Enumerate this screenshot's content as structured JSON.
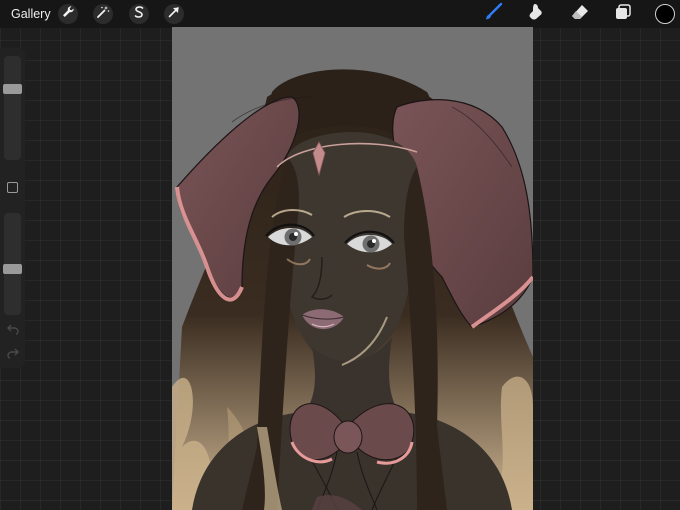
{
  "toolbar": {
    "gallery_label": "Gallery",
    "left_tools": [
      {
        "name": "actions",
        "icon": "wrench-icon"
      },
      {
        "name": "adjustments",
        "icon": "magic-wand-icon"
      },
      {
        "name": "selection",
        "icon": "selection-s-icon"
      },
      {
        "name": "transform",
        "icon": "arrow-cursor-icon"
      }
    ],
    "right_tools": [
      {
        "name": "brush",
        "icon": "brush-icon",
        "active": true
      },
      {
        "name": "smudge",
        "icon": "smudge-icon",
        "active": false
      },
      {
        "name": "eraser",
        "icon": "eraser-icon",
        "active": false
      },
      {
        "name": "layers",
        "icon": "layers-icon",
        "active": false
      }
    ],
    "current_color": "#000000"
  },
  "sidebar": {
    "size_slider_level": 0.7,
    "opacity_slider_level": 0.45,
    "modify_button_icon": "square-icon",
    "undo_icon": "undo-icon",
    "redo_icon": "redo-icon"
  },
  "canvas": {
    "background_color": "#737374",
    "artwork": "digital-painting-portrait",
    "colors": {
      "skin": "#3e3730",
      "hair": "#2b2118",
      "bow": "#6b4a4c",
      "bow_highlight": "#e79a9a",
      "hair_highlight": "#d7c5a6"
    }
  },
  "accent_color": "#2f7df6"
}
